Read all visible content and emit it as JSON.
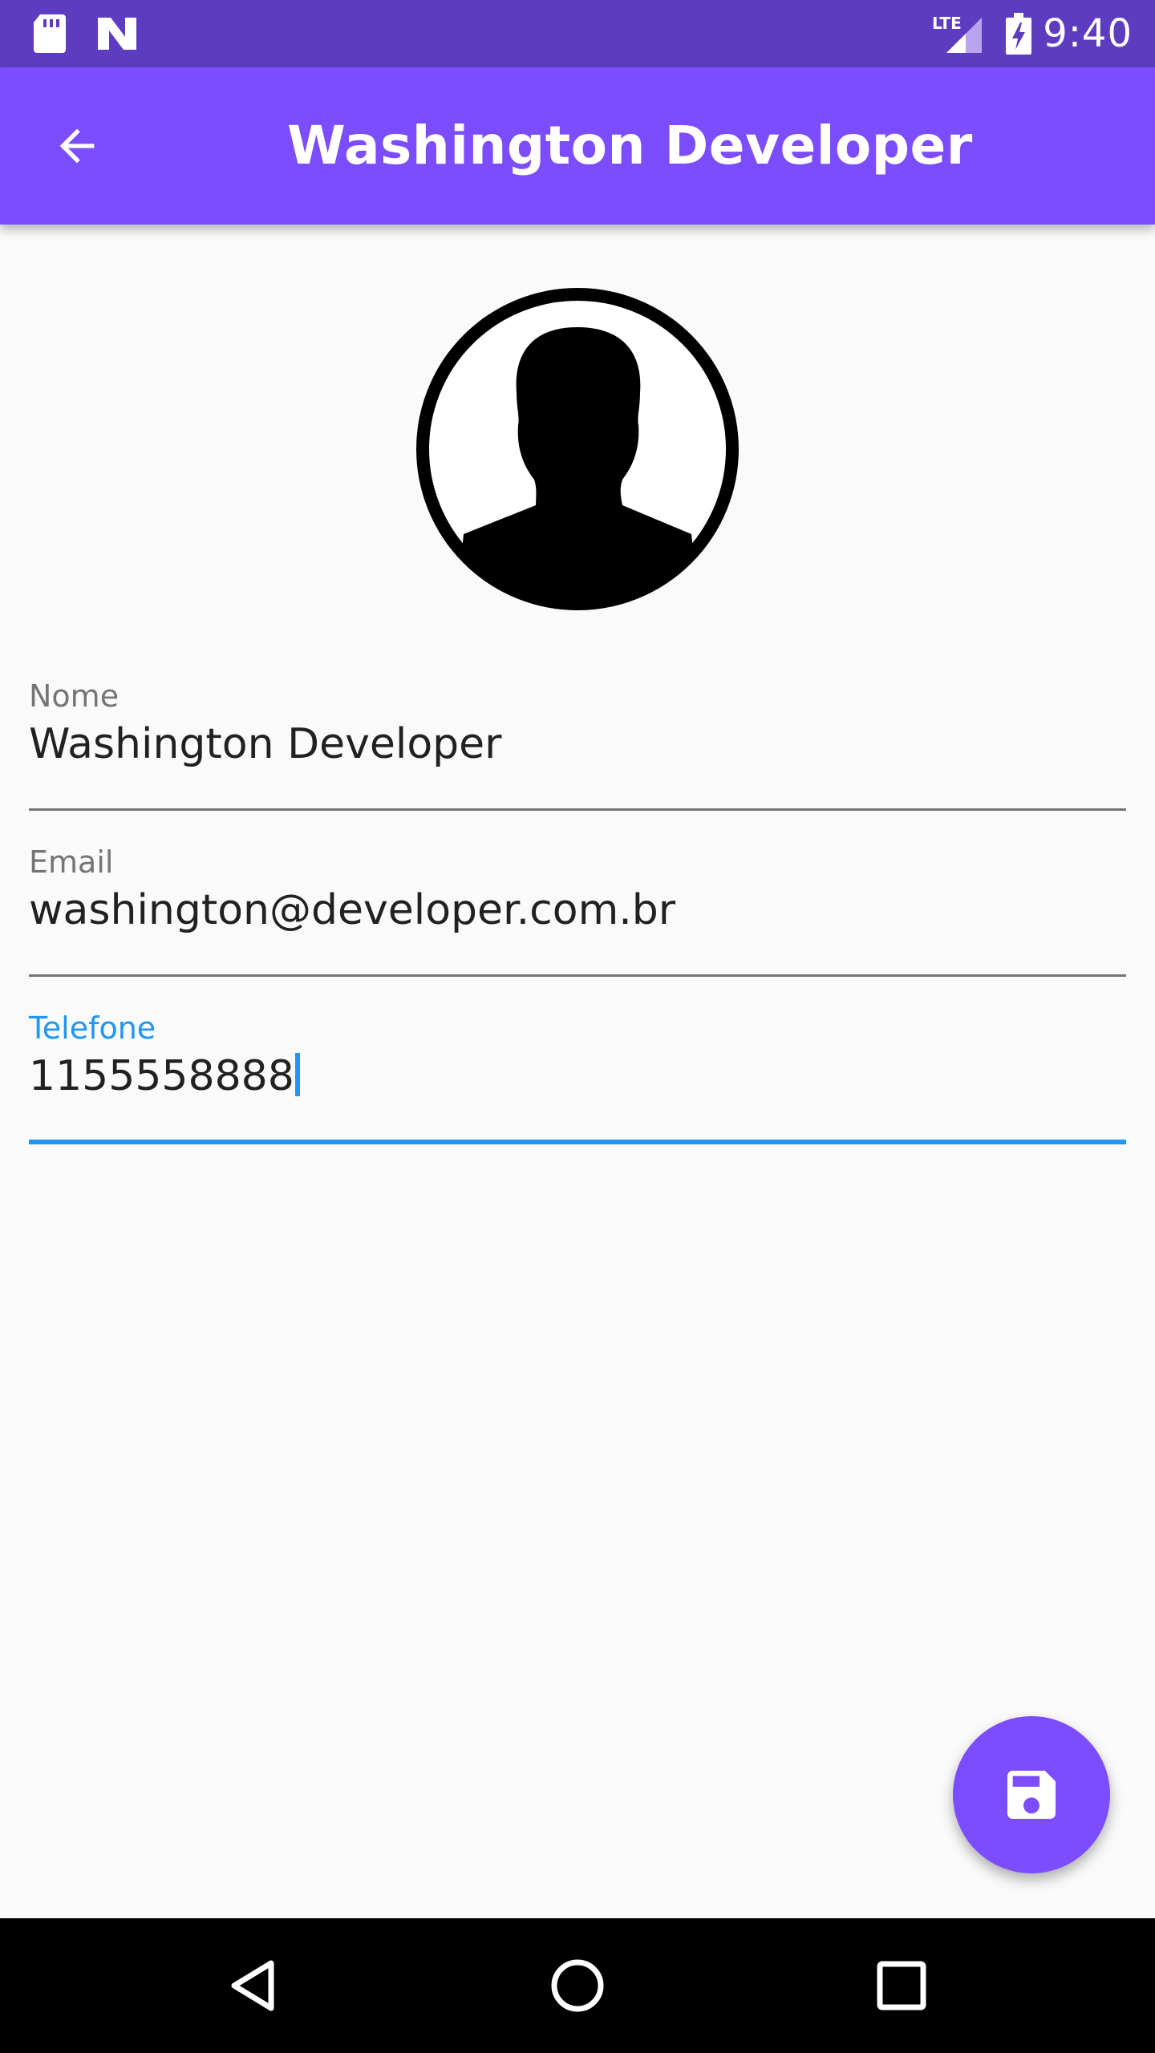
{
  "status_bar": {
    "time": "9:40",
    "icons": [
      "sd-card-icon",
      "n-notification-icon",
      "lte-signal-icon",
      "battery-charging-icon"
    ]
  },
  "app_bar": {
    "title": "Washington Developer",
    "back_icon": "arrow-back-icon"
  },
  "avatar": {
    "icon": "account-circle-icon"
  },
  "form": {
    "name": {
      "label": "Nome",
      "value": "Washington Developer"
    },
    "email": {
      "label": "Email",
      "value": "washington@developer.com.br"
    },
    "phone": {
      "label": "Telefone",
      "value": "1155558888",
      "focused": true
    }
  },
  "fab": {
    "icon": "save-icon"
  },
  "nav_bar": {
    "icons": [
      "back-triangle-icon",
      "home-circle-icon",
      "recents-square-icon"
    ]
  },
  "colors": {
    "status_bar": "#5E3CBF",
    "app_bar": "#7C4DFF",
    "accent": "#2196F3",
    "background": "#FAFAFA"
  }
}
